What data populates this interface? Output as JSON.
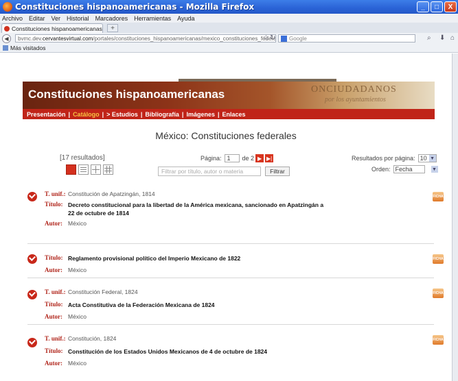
{
  "window": {
    "title": "Constituciones hispanoamericanas - Mozilla Firefox",
    "min": "_",
    "max": "□",
    "close": "X"
  },
  "menu": [
    "Archivo",
    "Editar",
    "Ver",
    "Historial",
    "Marcadores",
    "Herramientas",
    "Ayuda"
  ],
  "tab": {
    "label": "Constituciones hispanoamericanas",
    "new_tab": "+"
  },
  "nav": {
    "url_prefix": "bvmc.dev.",
    "url_host": "cervantesvirtual.com",
    "url_path": "/portales/constituciones_hispanoamericanas/mexico_constituciones_federales",
    "search_placeholder": "Google"
  },
  "bookmarks": {
    "label": "Más visitados"
  },
  "site": {
    "banner_title": "Constituciones hispanoamericanas",
    "banner_deco": "ONCIUDADANOS",
    "banner_deco2": "por los ayuntamientos",
    "nav": [
      "Presentación",
      "Catálogo",
      "> Estudios",
      "Bibliografía",
      "Imágenes",
      "Enlaces"
    ],
    "active_nav": "Catálogo",
    "page_title": "México: Constituciones federales"
  },
  "controls": {
    "results": "[17 resultados]",
    "page_label": "Página:",
    "page_value": "1",
    "page_of": "de 2",
    "per_page_label": "Resultados por página:",
    "per_page_value": "10",
    "filter_placeholder": "Filtrar por título, autor o materia",
    "filter_button": "Filtrar",
    "order_label": "Orden:",
    "order_value": "Fecha"
  },
  "labels": {
    "unif": "T. unif.:",
    "titulo": "Título:",
    "autor": "Autor:"
  },
  "items": [
    {
      "unif": "Constitución de Apatzingán, 1814",
      "titulo": "Decreto constitucional para la libertad de la América mexicana, sancionado en Apatzingán a 22 de octubre de 1814",
      "autor": "México"
    },
    {
      "titulo": "Reglamento provisional político del Imperio Mexicano de 1822",
      "autor": "México"
    },
    {
      "unif": "Constitución Federal, 1824",
      "titulo": "Acta Constitutiva de la Federación Mexicana de 1824",
      "autor": "México"
    },
    {
      "unif": "Constitución, 1824",
      "titulo": "Constitución de los Estados Unidos Mexicanos de 4 de octubre de 1824",
      "autor": "México"
    }
  ],
  "ficha_label": "FICHA",
  "colors": {
    "accent": "#c02418",
    "active_nav": "#f7c341",
    "titlebar": "#2a63d6"
  }
}
